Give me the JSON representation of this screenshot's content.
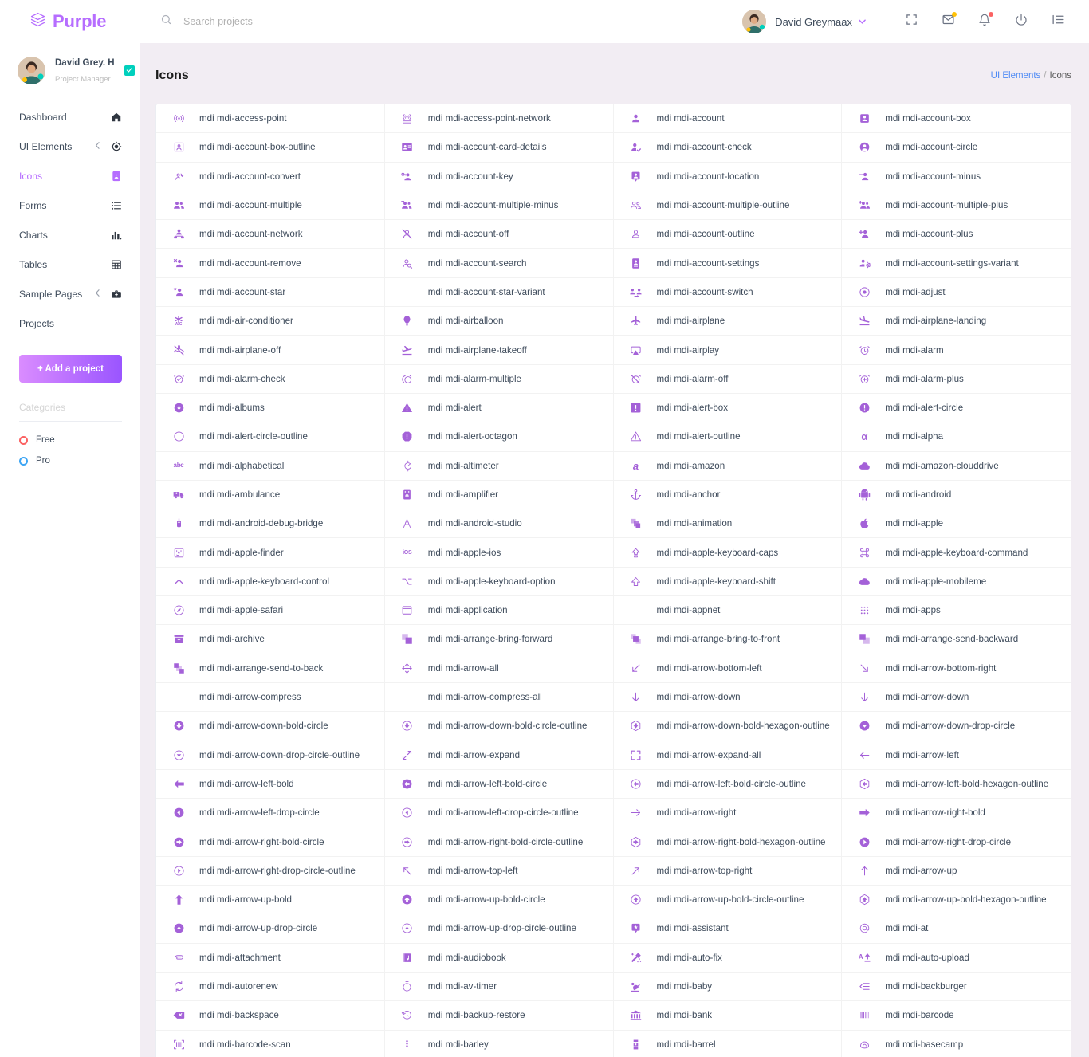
{
  "brand": {
    "name": "Purple"
  },
  "search": {
    "placeholder": "Search projects",
    "value": ""
  },
  "topbar": {
    "user_name": "David Greymaax",
    "caret": "⌄",
    "buttons": [
      {
        "name": "fullscreen-button",
        "label": ""
      },
      {
        "name": "messages-button",
        "label": ""
      },
      {
        "name": "notifications-button",
        "label": ""
      },
      {
        "name": "power-button",
        "label": ""
      },
      {
        "name": "list-toggle-button",
        "label": ""
      }
    ],
    "badge_color_mail": "#ffc107",
    "badge_color_bell": "#fb6262"
  },
  "profile": {
    "name": "David Grey. H",
    "role": "Project Manager",
    "badge_color": "#00d0bd"
  },
  "sidebar": {
    "items": [
      {
        "label": "Dashboard",
        "icon": "home-icon",
        "active": false,
        "expandable": false
      },
      {
        "label": "UI Elements",
        "icon": "crosshair-icon",
        "active": false,
        "expandable": true
      },
      {
        "label": "Icons",
        "icon": "contact-card-icon",
        "active": true,
        "expandable": false
      },
      {
        "label": "Forms",
        "icon": "list-icon",
        "active": false,
        "expandable": false
      },
      {
        "label": "Charts",
        "icon": "bar-chart-icon",
        "active": false,
        "expandable": false
      },
      {
        "label": "Tables",
        "icon": "grid-icon",
        "active": false,
        "expandable": false
      },
      {
        "label": "Sample Pages",
        "icon": "briefcase-icon",
        "active": false,
        "expandable": true
      }
    ],
    "projects_label": "Projects",
    "add_project_label": "+ Add a project",
    "categories_label": "Categories",
    "categories": [
      {
        "label": "Free",
        "color": "#fb6262"
      },
      {
        "label": "Pro",
        "color": "#3da5f4"
      }
    ]
  },
  "page": {
    "title": "Icons",
    "breadcrumb": {
      "parent": "UI Elements",
      "separator": "/",
      "current": "Icons"
    }
  },
  "icons": [
    {
      "name": "mdi mdi-access-point",
      "glyph": "access-point"
    },
    {
      "name": "mdi mdi-access-point-network",
      "glyph": "access-point-network"
    },
    {
      "name": "mdi mdi-account",
      "glyph": "account"
    },
    {
      "name": "mdi mdi-account-box",
      "glyph": "account-box"
    },
    {
      "name": "mdi mdi-account-box-outline",
      "glyph": "account-box-outline"
    },
    {
      "name": "mdi mdi-account-card-details",
      "glyph": "account-card-details"
    },
    {
      "name": "mdi mdi-account-check",
      "glyph": "account-check"
    },
    {
      "name": "mdi mdi-account-circle",
      "glyph": "account-circle"
    },
    {
      "name": "mdi mdi-account-convert",
      "glyph": "account-convert"
    },
    {
      "name": "mdi mdi-account-key",
      "glyph": "account-key"
    },
    {
      "name": "mdi mdi-account-location",
      "glyph": "account-location"
    },
    {
      "name": "mdi mdi-account-minus",
      "glyph": "account-minus"
    },
    {
      "name": "mdi mdi-account-multiple",
      "glyph": "account-multiple"
    },
    {
      "name": "mdi mdi-account-multiple-minus",
      "glyph": "account-multiple-minus"
    },
    {
      "name": "mdi mdi-account-multiple-outline",
      "glyph": "account-multiple-outline"
    },
    {
      "name": "mdi mdi-account-multiple-plus",
      "glyph": "account-multiple-plus"
    },
    {
      "name": "mdi mdi-account-network",
      "glyph": "account-network"
    },
    {
      "name": "mdi mdi-account-off",
      "glyph": "account-off"
    },
    {
      "name": "mdi mdi-account-outline",
      "glyph": "account-outline"
    },
    {
      "name": "mdi mdi-account-plus",
      "glyph": "account-plus"
    },
    {
      "name": "mdi mdi-account-remove",
      "glyph": "account-remove"
    },
    {
      "name": "mdi mdi-account-search",
      "glyph": "account-search"
    },
    {
      "name": "mdi mdi-account-settings",
      "glyph": "account-settings"
    },
    {
      "name": "mdi mdi-account-settings-variant",
      "glyph": "account-settings-variant"
    },
    {
      "name": "mdi mdi-account-star",
      "glyph": "account-star"
    },
    {
      "name": "mdi mdi-account-star-variant",
      "glyph": "none"
    },
    {
      "name": "mdi mdi-account-switch",
      "glyph": "account-switch"
    },
    {
      "name": "mdi mdi-adjust",
      "glyph": "adjust"
    },
    {
      "name": "mdi mdi-air-conditioner",
      "glyph": "air-conditioner"
    },
    {
      "name": "mdi mdi-airballoon",
      "glyph": "airballoon"
    },
    {
      "name": "mdi mdi-airplane",
      "glyph": "airplane"
    },
    {
      "name": "mdi mdi-airplane-landing",
      "glyph": "airplane-landing"
    },
    {
      "name": "mdi mdi-airplane-off",
      "glyph": "airplane-off"
    },
    {
      "name": "mdi mdi-airplane-takeoff",
      "glyph": "airplane-takeoff"
    },
    {
      "name": "mdi mdi-airplay",
      "glyph": "airplay"
    },
    {
      "name": "mdi mdi-alarm",
      "glyph": "alarm"
    },
    {
      "name": "mdi mdi-alarm-check",
      "glyph": "alarm-check"
    },
    {
      "name": "mdi mdi-alarm-multiple",
      "glyph": "alarm-multiple"
    },
    {
      "name": "mdi mdi-alarm-off",
      "glyph": "alarm-off"
    },
    {
      "name": "mdi mdi-alarm-plus",
      "glyph": "alarm-plus"
    },
    {
      "name": "mdi mdi-albums",
      "glyph": "albums"
    },
    {
      "name": "mdi mdi-alert",
      "glyph": "alert"
    },
    {
      "name": "mdi mdi-alert-box",
      "glyph": "alert-box"
    },
    {
      "name": "mdi mdi-alert-circle",
      "glyph": "alert-circle"
    },
    {
      "name": "mdi mdi-alert-circle-outline",
      "glyph": "alert-circle-outline"
    },
    {
      "name": "mdi mdi-alert-octagon",
      "glyph": "alert-octagon"
    },
    {
      "name": "mdi mdi-alert-outline",
      "glyph": "alert-outline"
    },
    {
      "name": "mdi mdi-alpha",
      "glyph": "alpha"
    },
    {
      "name": "mdi mdi-alphabetical",
      "glyph": "alphabetical"
    },
    {
      "name": "mdi mdi-altimeter",
      "glyph": "altimeter"
    },
    {
      "name": "mdi mdi-amazon",
      "glyph": "amazon"
    },
    {
      "name": "mdi mdi-amazon-clouddrive",
      "glyph": "cloud"
    },
    {
      "name": "mdi mdi-ambulance",
      "glyph": "ambulance"
    },
    {
      "name": "mdi mdi-amplifier",
      "glyph": "amplifier"
    },
    {
      "name": "mdi mdi-anchor",
      "glyph": "anchor"
    },
    {
      "name": "mdi mdi-android",
      "glyph": "android"
    },
    {
      "name": "mdi mdi-android-debug-bridge",
      "glyph": "android-debug-bridge"
    },
    {
      "name": "mdi mdi-android-studio",
      "glyph": "android-studio"
    },
    {
      "name": "mdi mdi-animation",
      "glyph": "animation"
    },
    {
      "name": "mdi mdi-apple",
      "glyph": "apple"
    },
    {
      "name": "mdi mdi-apple-finder",
      "glyph": "apple-finder"
    },
    {
      "name": "mdi mdi-apple-ios",
      "glyph": "apple-ios"
    },
    {
      "name": "mdi mdi-apple-keyboard-caps",
      "glyph": "keyboard-caps"
    },
    {
      "name": "mdi mdi-apple-keyboard-command",
      "glyph": "keyboard-command"
    },
    {
      "name": "mdi mdi-apple-keyboard-control",
      "glyph": "keyboard-control"
    },
    {
      "name": "mdi mdi-apple-keyboard-option",
      "glyph": "keyboard-option"
    },
    {
      "name": "mdi mdi-apple-keyboard-shift",
      "glyph": "keyboard-shift"
    },
    {
      "name": "mdi mdi-apple-mobileme",
      "glyph": "cloud"
    },
    {
      "name": "mdi mdi-apple-safari",
      "glyph": "apple-safari"
    },
    {
      "name": "mdi mdi-application",
      "glyph": "application"
    },
    {
      "name": "mdi mdi-appnet",
      "glyph": "none"
    },
    {
      "name": "mdi mdi-apps",
      "glyph": "apps"
    },
    {
      "name": "mdi mdi-archive",
      "glyph": "archive"
    },
    {
      "name": "mdi mdi-arrange-bring-forward",
      "glyph": "arrange-bring-forward"
    },
    {
      "name": "mdi mdi-arrange-bring-to-front",
      "glyph": "arrange-bring-to-front"
    },
    {
      "name": "mdi mdi-arrange-send-backward",
      "glyph": "arrange-send-backward"
    },
    {
      "name": "mdi mdi-arrange-send-to-back",
      "glyph": "arrange-send-to-back"
    },
    {
      "name": "mdi mdi-arrow-all",
      "glyph": "arrow-all"
    },
    {
      "name": "mdi mdi-arrow-bottom-left",
      "glyph": "arrow-bottom-left"
    },
    {
      "name": "mdi mdi-arrow-bottom-right",
      "glyph": "arrow-bottom-right"
    },
    {
      "name": "mdi mdi-arrow-compress",
      "glyph": "none"
    },
    {
      "name": "mdi mdi-arrow-compress-all",
      "glyph": "none"
    },
    {
      "name": "mdi mdi-arrow-down",
      "glyph": "arrow-down"
    },
    {
      "name": "mdi mdi-arrow-down",
      "glyph": "arrow-down"
    },
    {
      "name": "mdi mdi-arrow-down-bold-circle",
      "glyph": "arrow-down-bold-circle"
    },
    {
      "name": "mdi mdi-arrow-down-bold-circle-outline",
      "glyph": "arrow-down-bold-circle-outline"
    },
    {
      "name": "mdi mdi-arrow-down-bold-hexagon-outline",
      "glyph": "arrow-down-bold-hexagon-outline"
    },
    {
      "name": "mdi mdi-arrow-down-drop-circle",
      "glyph": "arrow-down-drop-circle"
    },
    {
      "name": "mdi mdi-arrow-down-drop-circle-outline",
      "glyph": "arrow-down-drop-circle-outline"
    },
    {
      "name": "mdi mdi-arrow-expand",
      "glyph": "arrow-expand"
    },
    {
      "name": "mdi mdi-arrow-expand-all",
      "glyph": "arrow-expand-all"
    },
    {
      "name": "mdi mdi-arrow-left",
      "glyph": "arrow-left"
    },
    {
      "name": "mdi mdi-arrow-left-bold",
      "glyph": "arrow-left-bold"
    },
    {
      "name": "mdi mdi-arrow-left-bold-circle",
      "glyph": "arrow-left-bold-circle"
    },
    {
      "name": "mdi mdi-arrow-left-bold-circle-outline",
      "glyph": "arrow-left-bold-circle-outline"
    },
    {
      "name": "mdi mdi-arrow-left-bold-hexagon-outline",
      "glyph": "arrow-left-bold-hexagon-outline"
    },
    {
      "name": "mdi mdi-arrow-left-drop-circle",
      "glyph": "arrow-left-drop-circle"
    },
    {
      "name": "mdi mdi-arrow-left-drop-circle-outline",
      "glyph": "arrow-left-drop-circle-outline"
    },
    {
      "name": "mdi mdi-arrow-right",
      "glyph": "arrow-right"
    },
    {
      "name": "mdi mdi-arrow-right-bold",
      "glyph": "arrow-right-bold"
    },
    {
      "name": "mdi mdi-arrow-right-bold-circle",
      "glyph": "arrow-right-bold-circle"
    },
    {
      "name": "mdi mdi-arrow-right-bold-circle-outline",
      "glyph": "arrow-right-bold-circle-outline"
    },
    {
      "name": "mdi mdi-arrow-right-bold-hexagon-outline",
      "glyph": "arrow-right-bold-hexagon-outline"
    },
    {
      "name": "mdi mdi-arrow-right-drop-circle",
      "glyph": "arrow-right-drop-circle"
    },
    {
      "name": "mdi mdi-arrow-right-drop-circle-outline",
      "glyph": "arrow-right-drop-circle-outline"
    },
    {
      "name": "mdi mdi-arrow-top-left",
      "glyph": "arrow-top-left"
    },
    {
      "name": "mdi mdi-arrow-top-right",
      "glyph": "arrow-top-right"
    },
    {
      "name": "mdi mdi-arrow-up",
      "glyph": "arrow-up"
    },
    {
      "name": "mdi mdi-arrow-up-bold",
      "glyph": "arrow-up-bold"
    },
    {
      "name": "mdi mdi-arrow-up-bold-circle",
      "glyph": "arrow-up-bold-circle"
    },
    {
      "name": "mdi mdi-arrow-up-bold-circle-outline",
      "glyph": "arrow-up-bold-circle-outline"
    },
    {
      "name": "mdi mdi-arrow-up-bold-hexagon-outline",
      "glyph": "arrow-up-bold-hexagon-outline"
    },
    {
      "name": "mdi mdi-arrow-up-drop-circle",
      "glyph": "arrow-up-drop-circle"
    },
    {
      "name": "mdi mdi-arrow-up-drop-circle-outline",
      "glyph": "arrow-up-drop-circle-outline"
    },
    {
      "name": "mdi mdi-assistant",
      "glyph": "assistant"
    },
    {
      "name": "mdi mdi-at",
      "glyph": "at"
    },
    {
      "name": "mdi mdi-attachment",
      "glyph": "attachment"
    },
    {
      "name": "mdi mdi-audiobook",
      "glyph": "audiobook"
    },
    {
      "name": "mdi mdi-auto-fix",
      "glyph": "auto-fix"
    },
    {
      "name": "mdi mdi-auto-upload",
      "glyph": "auto-upload"
    },
    {
      "name": "mdi mdi-autorenew",
      "glyph": "autorenew"
    },
    {
      "name": "mdi mdi-av-timer",
      "glyph": "av-timer"
    },
    {
      "name": "mdi mdi-baby",
      "glyph": "baby"
    },
    {
      "name": "mdi mdi-backburger",
      "glyph": "backburger"
    },
    {
      "name": "mdi mdi-backspace",
      "glyph": "backspace"
    },
    {
      "name": "mdi mdi-backup-restore",
      "glyph": "backup-restore"
    },
    {
      "name": "mdi mdi-bank",
      "glyph": "bank"
    },
    {
      "name": "mdi mdi-barcode",
      "glyph": "barcode"
    },
    {
      "name": "mdi mdi-barcode-scan",
      "glyph": "barcode-scan"
    },
    {
      "name": "mdi mdi-barley",
      "glyph": "barley"
    },
    {
      "name": "mdi mdi-barrel",
      "glyph": "barrel"
    },
    {
      "name": "mdi mdi-basecamp",
      "glyph": "basecamp"
    }
  ]
}
